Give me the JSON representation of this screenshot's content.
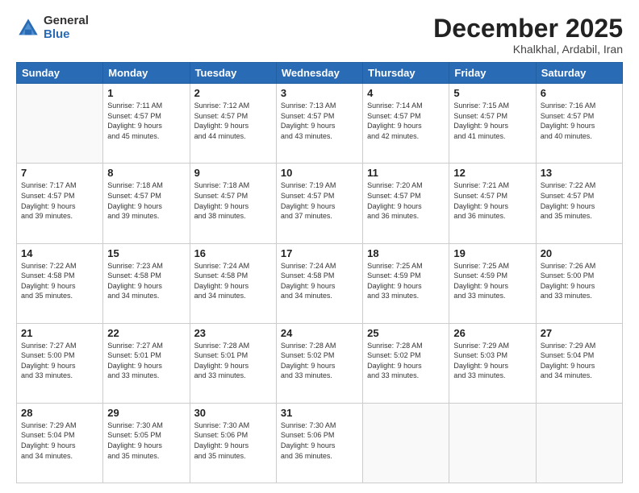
{
  "logo": {
    "general": "General",
    "blue": "Blue"
  },
  "header": {
    "month": "December 2025",
    "location": "Khalkhal, Ardabil, Iran"
  },
  "weekdays": [
    "Sunday",
    "Monday",
    "Tuesday",
    "Wednesday",
    "Thursday",
    "Friday",
    "Saturday"
  ],
  "weeks": [
    [
      {
        "day": "",
        "info": ""
      },
      {
        "day": "1",
        "info": "Sunrise: 7:11 AM\nSunset: 4:57 PM\nDaylight: 9 hours\nand 45 minutes."
      },
      {
        "day": "2",
        "info": "Sunrise: 7:12 AM\nSunset: 4:57 PM\nDaylight: 9 hours\nand 44 minutes."
      },
      {
        "day": "3",
        "info": "Sunrise: 7:13 AM\nSunset: 4:57 PM\nDaylight: 9 hours\nand 43 minutes."
      },
      {
        "day": "4",
        "info": "Sunrise: 7:14 AM\nSunset: 4:57 PM\nDaylight: 9 hours\nand 42 minutes."
      },
      {
        "day": "5",
        "info": "Sunrise: 7:15 AM\nSunset: 4:57 PM\nDaylight: 9 hours\nand 41 minutes."
      },
      {
        "day": "6",
        "info": "Sunrise: 7:16 AM\nSunset: 4:57 PM\nDaylight: 9 hours\nand 40 minutes."
      }
    ],
    [
      {
        "day": "7",
        "info": "Sunrise: 7:17 AM\nSunset: 4:57 PM\nDaylight: 9 hours\nand 39 minutes."
      },
      {
        "day": "8",
        "info": "Sunrise: 7:18 AM\nSunset: 4:57 PM\nDaylight: 9 hours\nand 39 minutes."
      },
      {
        "day": "9",
        "info": "Sunrise: 7:18 AM\nSunset: 4:57 PM\nDaylight: 9 hours\nand 38 minutes."
      },
      {
        "day": "10",
        "info": "Sunrise: 7:19 AM\nSunset: 4:57 PM\nDaylight: 9 hours\nand 37 minutes."
      },
      {
        "day": "11",
        "info": "Sunrise: 7:20 AM\nSunset: 4:57 PM\nDaylight: 9 hours\nand 36 minutes."
      },
      {
        "day": "12",
        "info": "Sunrise: 7:21 AM\nSunset: 4:57 PM\nDaylight: 9 hours\nand 36 minutes."
      },
      {
        "day": "13",
        "info": "Sunrise: 7:22 AM\nSunset: 4:57 PM\nDaylight: 9 hours\nand 35 minutes."
      }
    ],
    [
      {
        "day": "14",
        "info": "Sunrise: 7:22 AM\nSunset: 4:58 PM\nDaylight: 9 hours\nand 35 minutes."
      },
      {
        "day": "15",
        "info": "Sunrise: 7:23 AM\nSunset: 4:58 PM\nDaylight: 9 hours\nand 34 minutes."
      },
      {
        "day": "16",
        "info": "Sunrise: 7:24 AM\nSunset: 4:58 PM\nDaylight: 9 hours\nand 34 minutes."
      },
      {
        "day": "17",
        "info": "Sunrise: 7:24 AM\nSunset: 4:58 PM\nDaylight: 9 hours\nand 34 minutes."
      },
      {
        "day": "18",
        "info": "Sunrise: 7:25 AM\nSunset: 4:59 PM\nDaylight: 9 hours\nand 33 minutes."
      },
      {
        "day": "19",
        "info": "Sunrise: 7:25 AM\nSunset: 4:59 PM\nDaylight: 9 hours\nand 33 minutes."
      },
      {
        "day": "20",
        "info": "Sunrise: 7:26 AM\nSunset: 5:00 PM\nDaylight: 9 hours\nand 33 minutes."
      }
    ],
    [
      {
        "day": "21",
        "info": "Sunrise: 7:27 AM\nSunset: 5:00 PM\nDaylight: 9 hours\nand 33 minutes."
      },
      {
        "day": "22",
        "info": "Sunrise: 7:27 AM\nSunset: 5:01 PM\nDaylight: 9 hours\nand 33 minutes."
      },
      {
        "day": "23",
        "info": "Sunrise: 7:28 AM\nSunset: 5:01 PM\nDaylight: 9 hours\nand 33 minutes."
      },
      {
        "day": "24",
        "info": "Sunrise: 7:28 AM\nSunset: 5:02 PM\nDaylight: 9 hours\nand 33 minutes."
      },
      {
        "day": "25",
        "info": "Sunrise: 7:28 AM\nSunset: 5:02 PM\nDaylight: 9 hours\nand 33 minutes."
      },
      {
        "day": "26",
        "info": "Sunrise: 7:29 AM\nSunset: 5:03 PM\nDaylight: 9 hours\nand 33 minutes."
      },
      {
        "day": "27",
        "info": "Sunrise: 7:29 AM\nSunset: 5:04 PM\nDaylight: 9 hours\nand 34 minutes."
      }
    ],
    [
      {
        "day": "28",
        "info": "Sunrise: 7:29 AM\nSunset: 5:04 PM\nDaylight: 9 hours\nand 34 minutes."
      },
      {
        "day": "29",
        "info": "Sunrise: 7:30 AM\nSunset: 5:05 PM\nDaylight: 9 hours\nand 35 minutes."
      },
      {
        "day": "30",
        "info": "Sunrise: 7:30 AM\nSunset: 5:06 PM\nDaylight: 9 hours\nand 35 minutes."
      },
      {
        "day": "31",
        "info": "Sunrise: 7:30 AM\nSunset: 5:06 PM\nDaylight: 9 hours\nand 36 minutes."
      },
      {
        "day": "",
        "info": ""
      },
      {
        "day": "",
        "info": ""
      },
      {
        "day": "",
        "info": ""
      }
    ]
  ]
}
